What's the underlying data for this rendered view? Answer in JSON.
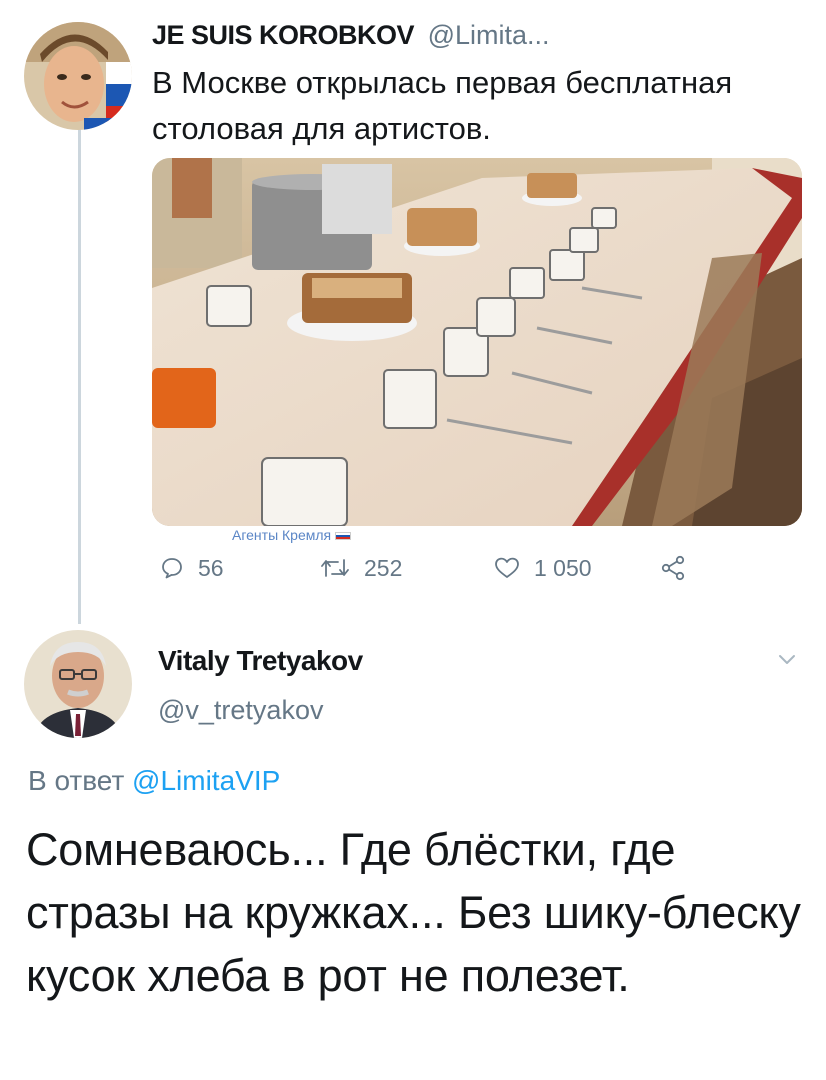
{
  "tweet1": {
    "author_name": "JE SUIS KOROBKOV",
    "author_handle": "@Limita...",
    "text": "В Москве открылась первая бесплатная столовая для артистов.",
    "image_watermark": "Агенты Кремля",
    "stats": {
      "replies": "56",
      "retweets": "252",
      "likes": "1 050"
    },
    "icons": [
      "reply-icon",
      "retweet-icon",
      "like-icon",
      "share-icon"
    ]
  },
  "tweet2": {
    "author_name": "Vitaly Tretyakov",
    "author_handle": "@v_tretyakov",
    "reply_prefix": "В ответ",
    "reply_mention": "@LimitaVIP",
    "text": "Сомневаюсь... Где блёстки, где стразы на кружках... Без шику-блеску кусок хлеба в рот не полезет."
  },
  "colors": {
    "text_primary": "#14171a",
    "text_secondary": "#657786",
    "link": "#1da1f2",
    "thread_line": "#ccd6dd",
    "watermark": "#5b86c6"
  }
}
